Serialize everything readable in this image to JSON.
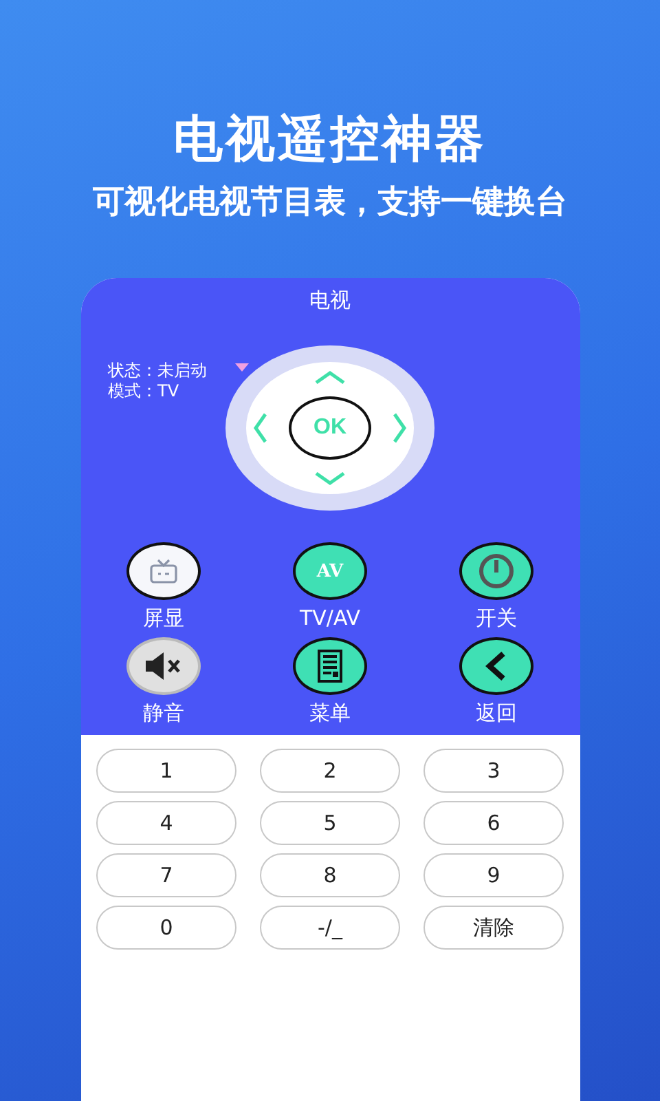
{
  "headline": "电视遥控神器",
  "subtitle": "可视化电视节目表，支持一键换台",
  "remote": {
    "title": "电视",
    "status_label": "状态：",
    "status": "未启动",
    "mode_label": "模式：",
    "mode": "TV",
    "ok": "OK",
    "buttons": [
      {
        "kind": "tv",
        "label": "屏显"
      },
      {
        "kind": "av",
        "label": "TV/AV",
        "icon_text": "AV"
      },
      {
        "kind": "power",
        "label": "开关"
      },
      {
        "kind": "mute",
        "label": "静音"
      },
      {
        "kind": "menu",
        "label": "菜单"
      },
      {
        "kind": "back",
        "label": "返回"
      }
    ],
    "keys": [
      "1",
      "2",
      "3",
      "4",
      "5",
      "6",
      "7",
      "8",
      "9",
      "0",
      "-/_",
      "清除"
    ]
  }
}
